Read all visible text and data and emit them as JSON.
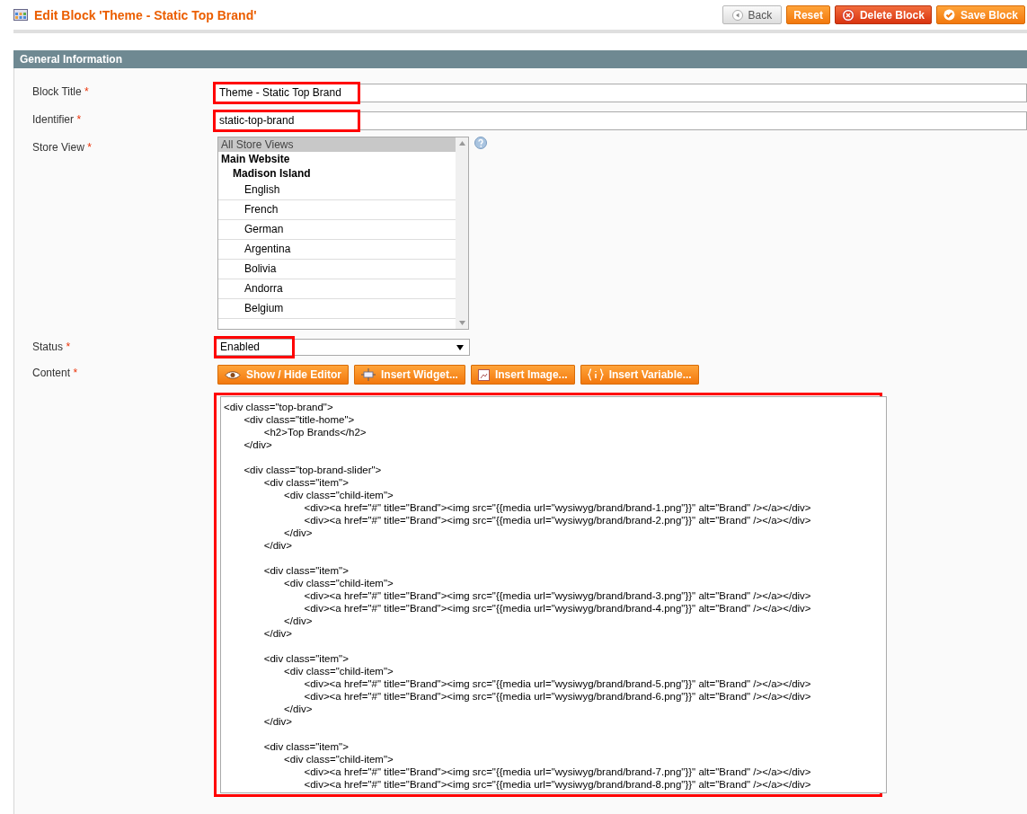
{
  "page": {
    "title": "Edit Block 'Theme - Static Top Brand'"
  },
  "actions": [
    {
      "label": "Back",
      "kind": "back"
    },
    {
      "label": "Reset",
      "kind": "reset"
    },
    {
      "label": "Delete Block",
      "kind": "delete"
    },
    {
      "label": "Save Block",
      "kind": "save"
    }
  ],
  "section": {
    "title": "General Information"
  },
  "fields": [
    {
      "label": "Block Title",
      "required": "*",
      "kind": "text",
      "value": "Theme - Static Top Brand",
      "highlighted": true
    },
    {
      "label": "Identifier",
      "required": "*",
      "kind": "text",
      "value": "static-top-brand",
      "highlighted": true
    },
    {
      "label": "Store View",
      "required": "*",
      "kind": "multiselect",
      "options": [
        {
          "label": "All Store Views",
          "selected": true
        },
        {
          "label": "Main Website",
          "selected": false,
          "children": [
            {
              "label": "Madison Island",
              "selected": false,
              "children": [
                {
                  "label": "English",
                  "selected": false
                },
                {
                  "label": "French",
                  "selected": false
                },
                {
                  "label": "German",
                  "selected": false
                },
                {
                  "label": "Argentina",
                  "selected": false
                },
                {
                  "label": "Bolivia",
                  "selected": false
                },
                {
                  "label": "Andorra",
                  "selected": false
                },
                {
                  "label": "Belgium",
                  "selected": false
                }
              ]
            }
          ]
        }
      ]
    },
    {
      "label": "Status",
      "required": "*",
      "kind": "select",
      "value": "Enabled",
      "highlighted": true
    },
    {
      "label": "Content",
      "required": "*",
      "kind": "editor",
      "highlighted": true,
      "tools": [
        {
          "label": "Show / Hide Editor",
          "kind": "eye"
        },
        {
          "label": "Insert Widget...",
          "kind": "widget"
        },
        {
          "label": "Insert Image...",
          "kind": "image"
        },
        {
          "label": "Insert Variable...",
          "kind": "variable"
        }
      ],
      "value": "<div class=\"top-brand\">\n\t<div class=\"title-home\">\n\t\t<h2>Top Brands</h2>\n\t</div>\n\n\t<div class=\"top-brand-slider\">\n\t\t<div class=\"item\">\n\t\t\t<div class=\"child-item\">\n\t\t\t\t<div><a href=\"#\" title=\"Brand\"><img src=\"{{media url=\"wysiwyg/brand/brand-1.png\"}}\" alt=\"Brand\" /></a></div>\n\t\t\t\t<div><a href=\"#\" title=\"Brand\"><img src=\"{{media url=\"wysiwyg/brand/brand-2.png\"}}\" alt=\"Brand\" /></a></div>\n\t\t\t</div>\n\t\t</div>\n\n\t\t<div class=\"item\">\n\t\t\t<div class=\"child-item\">\n\t\t\t\t<div><a href=\"#\" title=\"Brand\"><img src=\"{{media url=\"wysiwyg/brand/brand-3.png\"}}\" alt=\"Brand\" /></a></div>\n\t\t\t\t<div><a href=\"#\" title=\"Brand\"><img src=\"{{media url=\"wysiwyg/brand/brand-4.png\"}}\" alt=\"Brand\" /></a></div>\n\t\t\t</div>\n\t\t</div>\n\n\t\t<div class=\"item\">\n\t\t\t<div class=\"child-item\">\n\t\t\t\t<div><a href=\"#\" title=\"Brand\"><img src=\"{{media url=\"wysiwyg/brand/brand-5.png\"}}\" alt=\"Brand\" /></a></div>\n\t\t\t\t<div><a href=\"#\" title=\"Brand\"><img src=\"{{media url=\"wysiwyg/brand/brand-6.png\"}}\" alt=\"Brand\" /></a></div>\n\t\t\t</div>\n\t\t</div>\n\n\t\t<div class=\"item\">\n\t\t\t<div class=\"child-item\">\n\t\t\t\t<div><a href=\"#\" title=\"Brand\"><img src=\"{{media url=\"wysiwyg/brand/brand-7.png\"}}\" alt=\"Brand\" /></a></div>\n\t\t\t\t<div><a href=\"#\" title=\"Brand\"><img src=\"{{media url=\"wysiwyg/brand/brand-8.png\"}}\" alt=\"Brand\" /></a></div>"
    }
  ]
}
